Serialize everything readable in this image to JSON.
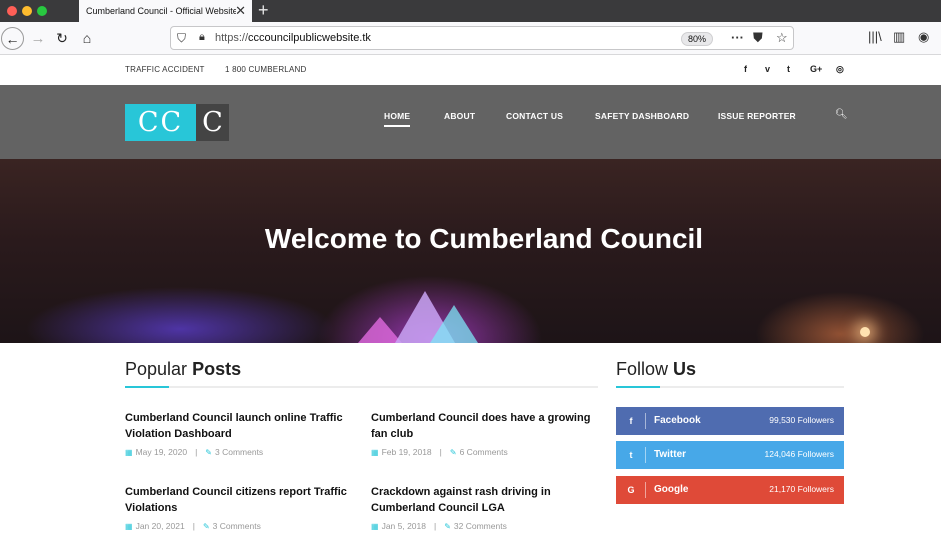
{
  "browser": {
    "tab_title": "Cumberland Council - Official Website",
    "tab_close": "✕",
    "new_tab": "+",
    "url_protocol": "https://",
    "url_host": "cccouncilpublicwebsite.tk",
    "zoom": "80%"
  },
  "topbar": {
    "accident_label": "TRAFFIC ACCIDENT",
    "phone": "1 800 CUMBERLAND",
    "social": [
      "f",
      "v",
      "t",
      "G+",
      "◎"
    ]
  },
  "header": {
    "logo_left": "CC",
    "logo_right": "C",
    "menu": [
      "HOME",
      "ABOUT",
      "CONTACT US",
      "SAFETY DASHBOARD",
      "ISSUE REPORTER"
    ],
    "active_menu": "HOME"
  },
  "hero": {
    "title": "Welcome to Cumberland Council"
  },
  "popular": {
    "title_light": "Popular",
    "title_bold": "Posts",
    "posts": [
      {
        "title": "Cumberland Council launch online Traffic Violation Dashboard",
        "date": "May 19, 2020",
        "comments": "3 Comments"
      },
      {
        "title": "Cumberland Council does have a growing fan club",
        "date": "Feb 19, 2018",
        "comments": "6 Comments"
      },
      {
        "title": "Cumberland Council citizens report Traffic Violations",
        "date": "Jan 20, 2021",
        "comments": "3 Comments"
      },
      {
        "title": "Crackdown against rash driving in Cumberland Council LGA",
        "date": "Jan 5, 2018",
        "comments": "32 Comments"
      }
    ]
  },
  "follow": {
    "title_light": "Follow",
    "title_bold": "Us",
    "networks": [
      {
        "icon": "f",
        "name": "Facebook",
        "followers": "99,530 Followers",
        "color": "#4f6cb0"
      },
      {
        "icon": "t",
        "name": "Twitter",
        "followers": "124,046 Followers",
        "color": "#47a8e8"
      },
      {
        "icon": "G",
        "name": "Google",
        "followers": "21,170 Followers",
        "color": "#df4a38"
      }
    ]
  },
  "colors": {
    "accent": "#28c6d8",
    "header_bg": "#636363"
  }
}
